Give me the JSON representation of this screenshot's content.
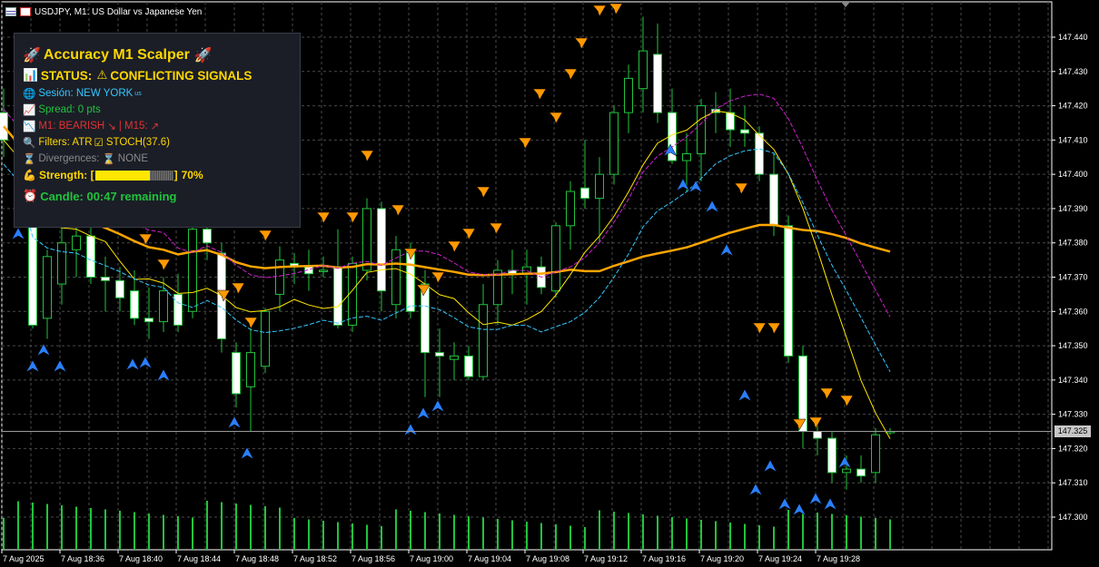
{
  "window": {
    "title": "USDJPY, M1:  US Dollar vs Japanese Yen"
  },
  "panel": {
    "title": "Accuracy M1 Scalper",
    "status_label": "STATUS:",
    "status_value": "CONFLICTING SIGNALS",
    "session_label": "Sesión: NEW YORK",
    "session_flag": "us",
    "spread": "Spread: 0 pts",
    "signal_m1": "M1: BEARISH",
    "signal_m15": "| M15:",
    "filters_atr": "Filters: ATR",
    "filters_stoch": "STOCH(37.6)",
    "divergences_label": "Divergences:",
    "divergences_value": "NONE",
    "strength_label": "Strength: [",
    "strength_end": "]",
    "strength_percent": "70%",
    "strength_value": 0.7,
    "candle": "Candle: 00:47 remaining"
  },
  "colors": {
    "bull": "#21c33c",
    "bear_body": "#ffffff",
    "ma_orange": "#ffa500",
    "ma_yellow": "#ffe600",
    "ma_magenta": "#d020d0",
    "ma_cyan": "#33c7ff",
    "arrow_up": "#2a7fff",
    "arrow_down": "#ff9900",
    "panel_title": "#ffd700"
  },
  "price_axis": {
    "ticks": [
      "147.440",
      "147.430",
      "147.420",
      "147.410",
      "147.400",
      "147.390",
      "147.380",
      "147.370",
      "147.360",
      "147.350",
      "147.340",
      "147.330",
      "147.320",
      "147.310",
      "147.300"
    ],
    "current_price": "147.325"
  },
  "time_axis": {
    "labels": [
      "7 Aug 2025",
      "7 Aug 18:36",
      "7 Aug 18:40",
      "7 Aug 18:44",
      "7 Aug 18:48",
      "7 Aug 18:52",
      "7 Aug 18:56",
      "7 Aug 19:00",
      "7 Aug 19:04",
      "7 Aug 19:08",
      "7 Aug 19:12",
      "7 Aug 19:16",
      "7 Aug 19:20",
      "7 Aug 19:24",
      "7 Aug 19:28"
    ]
  },
  "chart_data": {
    "type": "candlestick",
    "symbol": "USDJPY",
    "timeframe": "M1",
    "ylim": [
      147.29,
      147.45
    ],
    "candles": [
      {
        "o": 147.418,
        "h": 147.425,
        "l": 147.405,
        "c": 147.41
      },
      {
        "o": 147.412,
        "h": 147.416,
        "l": 147.398,
        "c": 147.4
      },
      {
        "o": 147.385,
        "h": 147.392,
        "l": 147.355,
        "c": 147.356
      },
      {
        "o": 147.358,
        "h": 147.378,
        "l": 147.352,
        "c": 147.376
      },
      {
        "o": 147.368,
        "h": 147.385,
        "l": 147.362,
        "c": 147.38
      },
      {
        "o": 147.378,
        "h": 147.386,
        "l": 147.37,
        "c": 147.382
      },
      {
        "o": 147.382,
        "h": 147.388,
        "l": 147.368,
        "c": 147.37
      },
      {
        "o": 147.37,
        "h": 147.376,
        "l": 147.36,
        "c": 147.369
      },
      {
        "o": 147.369,
        "h": 147.373,
        "l": 147.36,
        "c": 147.364
      },
      {
        "o": 147.366,
        "h": 147.372,
        "l": 147.356,
        "c": 147.358
      },
      {
        "o": 147.358,
        "h": 147.367,
        "l": 147.352,
        "c": 147.357
      },
      {
        "o": 147.357,
        "h": 147.37,
        "l": 147.354,
        "c": 147.366
      },
      {
        "o": 147.365,
        "h": 147.371,
        "l": 147.354,
        "c": 147.356
      },
      {
        "o": 147.36,
        "h": 147.385,
        "l": 147.358,
        "c": 147.384
      },
      {
        "o": 147.384,
        "h": 147.388,
        "l": 147.375,
        "c": 147.38
      },
      {
        "o": 147.377,
        "h": 147.38,
        "l": 147.348,
        "c": 147.352
      },
      {
        "o": 147.348,
        "h": 147.351,
        "l": 147.332,
        "c": 147.336
      },
      {
        "o": 147.338,
        "h": 147.356,
        "l": 147.325,
        "c": 147.348
      },
      {
        "o": 147.344,
        "h": 147.361,
        "l": 147.342,
        "c": 147.36
      },
      {
        "o": 147.365,
        "h": 147.379,
        "l": 147.36,
        "c": 147.375
      },
      {
        "o": 147.374,
        "h": 147.377,
        "l": 147.368,
        "c": 147.373
      },
      {
        "o": 147.373,
        "h": 147.378,
        "l": 147.366,
        "c": 147.371
      },
      {
        "o": 147.372,
        "h": 147.376,
        "l": 147.37,
        "c": 147.372
      },
      {
        "o": 147.373,
        "h": 147.384,
        "l": 147.355,
        "c": 147.356
      },
      {
        "o": 147.356,
        "h": 147.376,
        "l": 147.354,
        "c": 147.374
      },
      {
        "o": 147.372,
        "h": 147.393,
        "l": 147.369,
        "c": 147.39
      },
      {
        "o": 147.39,
        "h": 147.392,
        "l": 147.36,
        "c": 147.366
      },
      {
        "o": 147.362,
        "h": 147.382,
        "l": 147.358,
        "c": 147.378
      },
      {
        "o": 147.378,
        "h": 147.38,
        "l": 147.358,
        "c": 147.36
      },
      {
        "o": 147.368,
        "h": 147.372,
        "l": 147.335,
        "c": 147.348
      },
      {
        "o": 147.348,
        "h": 147.355,
        "l": 147.335,
        "c": 147.347
      },
      {
        "o": 147.346,
        "h": 147.351,
        "l": 147.34,
        "c": 147.347
      },
      {
        "o": 147.347,
        "h": 147.35,
        "l": 147.34,
        "c": 147.341
      },
      {
        "o": 147.341,
        "h": 147.368,
        "l": 147.34,
        "c": 147.362
      },
      {
        "o": 147.362,
        "h": 147.375,
        "l": 147.356,
        "c": 147.372
      },
      {
        "o": 147.372,
        "h": 147.378,
        "l": 147.365,
        "c": 147.371
      },
      {
        "o": 147.371,
        "h": 147.378,
        "l": 147.362,
        "c": 147.373
      },
      {
        "o": 147.373,
        "h": 147.376,
        "l": 147.365,
        "c": 147.367
      },
      {
        "o": 147.366,
        "h": 147.386,
        "l": 147.364,
        "c": 147.385
      },
      {
        "o": 147.385,
        "h": 147.398,
        "l": 147.378,
        "c": 147.395
      },
      {
        "o": 147.396,
        "h": 147.41,
        "l": 147.39,
        "c": 147.393
      },
      {
        "o": 147.393,
        "h": 147.405,
        "l": 147.38,
        "c": 147.4
      },
      {
        "o": 147.4,
        "h": 147.42,
        "l": 147.397,
        "c": 147.418
      },
      {
        "o": 147.418,
        "h": 147.432,
        "l": 147.412,
        "c": 147.428
      },
      {
        "o": 147.425,
        "h": 147.446,
        "l": 147.418,
        "c": 147.436
      },
      {
        "o": 147.435,
        "h": 147.444,
        "l": 147.415,
        "c": 147.418
      },
      {
        "o": 147.418,
        "h": 147.425,
        "l": 147.403,
        "c": 147.404
      },
      {
        "o": 147.404,
        "h": 147.412,
        "l": 147.395,
        "c": 147.406
      },
      {
        "o": 147.406,
        "h": 147.422,
        "l": 147.398,
        "c": 147.42
      },
      {
        "o": 147.419,
        "h": 147.424,
        "l": 147.412,
        "c": 147.418
      },
      {
        "o": 147.418,
        "h": 147.425,
        "l": 147.408,
        "c": 147.413
      },
      {
        "o": 147.413,
        "h": 147.42,
        "l": 147.408,
        "c": 147.412
      },
      {
        "o": 147.412,
        "h": 147.414,
        "l": 147.398,
        "c": 147.4
      },
      {
        "o": 147.4,
        "h": 147.406,
        "l": 147.382,
        "c": 147.385
      },
      {
        "o": 147.385,
        "h": 147.388,
        "l": 147.345,
        "c": 147.347
      },
      {
        "o": 147.347,
        "h": 147.35,
        "l": 147.32,
        "c": 147.325
      },
      {
        "o": 147.325,
        "h": 147.328,
        "l": 147.318,
        "c": 147.323
      },
      {
        "o": 147.323,
        "h": 147.325,
        "l": 147.31,
        "c": 147.313
      },
      {
        "o": 147.313,
        "h": 147.318,
        "l": 147.308,
        "c": 147.314
      },
      {
        "o": 147.314,
        "h": 147.318,
        "l": 147.31,
        "c": 147.312
      },
      {
        "o": 147.313,
        "h": 147.326,
        "l": 147.31,
        "c": 147.324
      },
      {
        "o": 147.325,
        "h": 147.326,
        "l": 147.324,
        "c": 147.325
      }
    ]
  }
}
